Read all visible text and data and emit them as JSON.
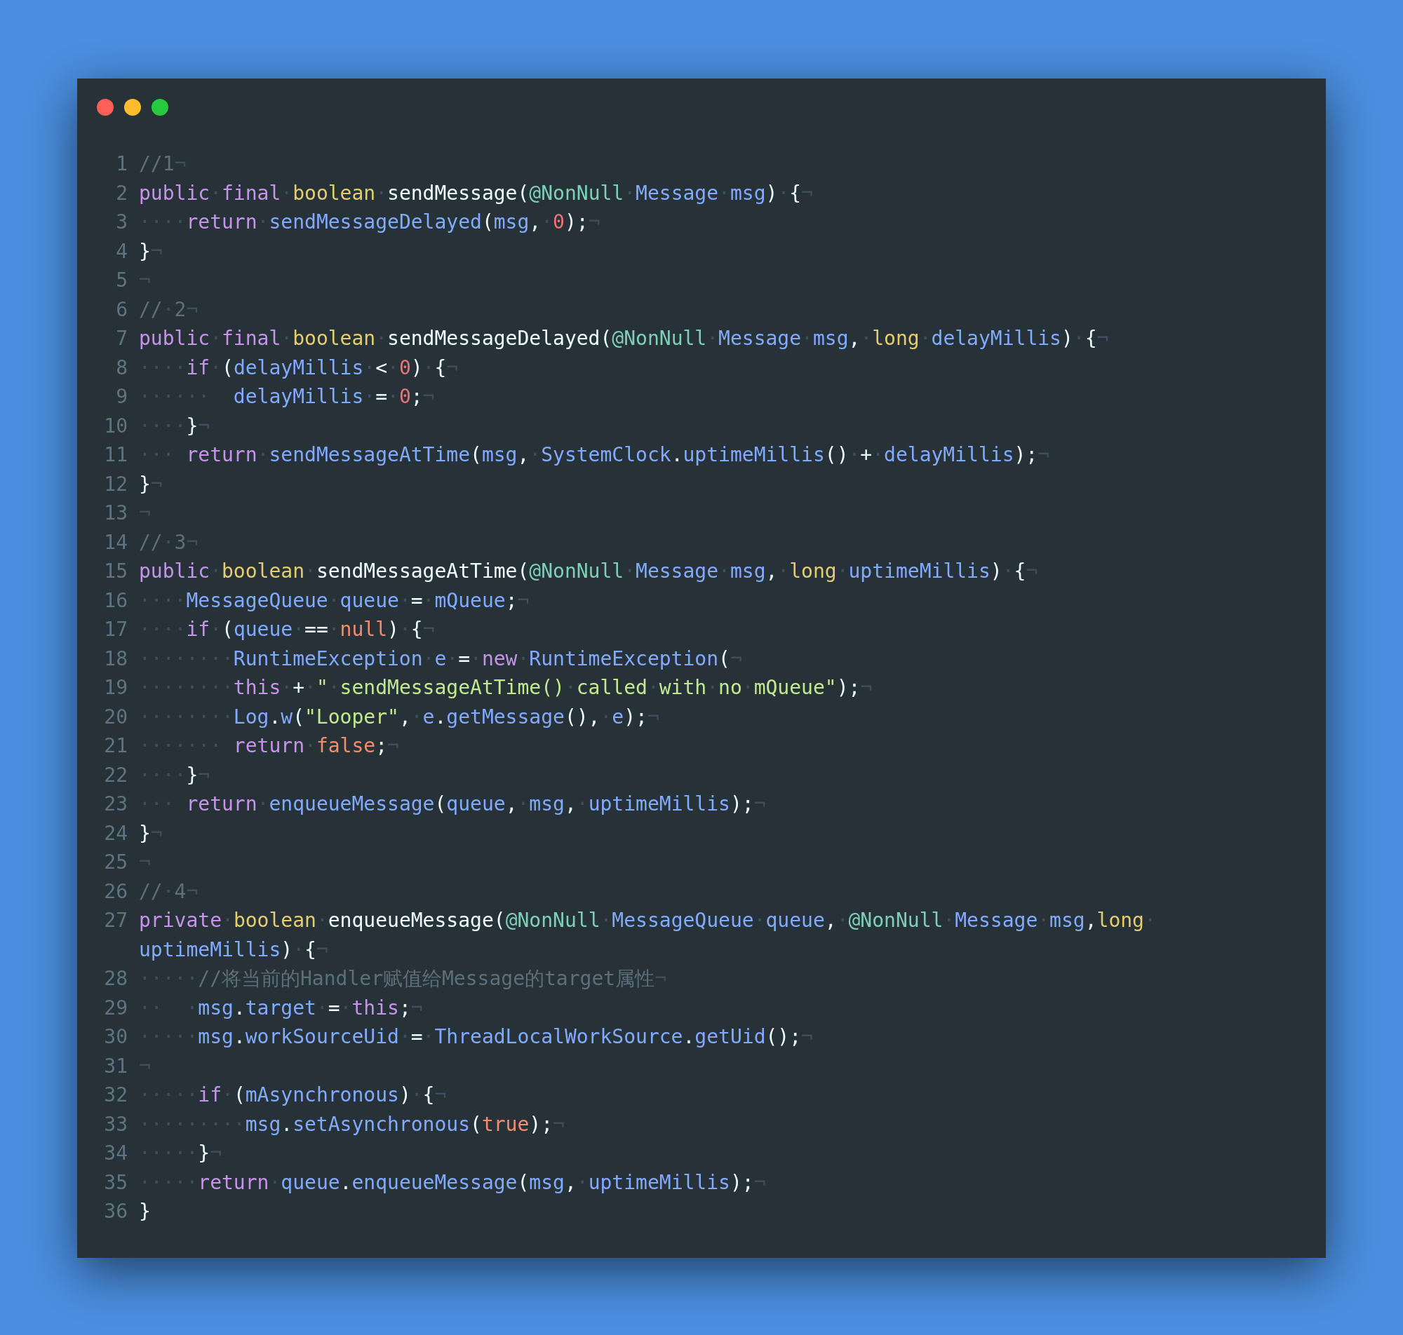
{
  "window": {
    "controls": [
      {
        "color": "#ff5f56"
      },
      {
        "color": "#ffbd2e"
      },
      {
        "color": "#27c93f"
      }
    ]
  },
  "code": {
    "lines": [
      {
        "number": "1",
        "tokens": [
          {
            "kind": "c",
            "text": "//1"
          },
          {
            "kind": "w",
            "text": "¬"
          }
        ]
      },
      {
        "number": "2",
        "tokens": [
          {
            "kind": "k",
            "text": "public"
          },
          {
            "kind": "w",
            "text": "·"
          },
          {
            "kind": "k",
            "text": "final"
          },
          {
            "kind": "w",
            "text": "·"
          },
          {
            "kind": "t",
            "text": "boolean"
          },
          {
            "kind": "w",
            "text": "·"
          },
          {
            "kind": "d",
            "text": "sendMessage"
          },
          {
            "kind": "p",
            "text": "("
          },
          {
            "kind": "a",
            "text": "@NonNull"
          },
          {
            "kind": "w",
            "text": "·"
          },
          {
            "kind": "i",
            "text": "Message"
          },
          {
            "kind": "w",
            "text": "·"
          },
          {
            "kind": "i",
            "text": "msg"
          },
          {
            "kind": "p",
            "text": ")"
          },
          {
            "kind": "w",
            "text": "·"
          },
          {
            "kind": "p",
            "text": "{"
          },
          {
            "kind": "w",
            "text": "¬"
          }
        ]
      },
      {
        "number": "3",
        "tokens": [
          {
            "kind": "w",
            "text": "····"
          },
          {
            "kind": "k",
            "text": "return"
          },
          {
            "kind": "w",
            "text": "·"
          },
          {
            "kind": "i",
            "text": "sendMessageDelayed"
          },
          {
            "kind": "p",
            "text": "("
          },
          {
            "kind": "i",
            "text": "msg"
          },
          {
            "kind": "p",
            "text": ","
          },
          {
            "kind": "w",
            "text": "·"
          },
          {
            "kind": "n",
            "text": "0"
          },
          {
            "kind": "p",
            "text": ");"
          },
          {
            "kind": "w",
            "text": "¬"
          }
        ]
      },
      {
        "number": "4",
        "tokens": [
          {
            "kind": "p",
            "text": "}"
          },
          {
            "kind": "w",
            "text": "¬"
          }
        ]
      },
      {
        "number": "5",
        "tokens": [
          {
            "kind": "w",
            "text": "¬"
          }
        ]
      },
      {
        "number": "6",
        "tokens": [
          {
            "kind": "c",
            "text": "//"
          },
          {
            "kind": "w",
            "text": "·"
          },
          {
            "kind": "c",
            "text": "2"
          },
          {
            "kind": "w",
            "text": "¬"
          }
        ]
      },
      {
        "number": "7",
        "tokens": [
          {
            "kind": "k",
            "text": "public"
          },
          {
            "kind": "w",
            "text": "·"
          },
          {
            "kind": "k",
            "text": "final"
          },
          {
            "kind": "w",
            "text": "·"
          },
          {
            "kind": "t",
            "text": "boolean"
          },
          {
            "kind": "w",
            "text": "·"
          },
          {
            "kind": "d",
            "text": "sendMessageDelayed"
          },
          {
            "kind": "p",
            "text": "("
          },
          {
            "kind": "a",
            "text": "@NonNull"
          },
          {
            "kind": "w",
            "text": "·"
          },
          {
            "kind": "i",
            "text": "Message"
          },
          {
            "kind": "w",
            "text": "·"
          },
          {
            "kind": "i",
            "text": "msg"
          },
          {
            "kind": "p",
            "text": ","
          },
          {
            "kind": "w",
            "text": "·"
          },
          {
            "kind": "t",
            "text": "long"
          },
          {
            "kind": "w",
            "text": "·"
          },
          {
            "kind": "i",
            "text": "delayMillis"
          },
          {
            "kind": "p",
            "text": ")"
          },
          {
            "kind": "w",
            "text": "·"
          },
          {
            "kind": "p",
            "text": "{"
          },
          {
            "kind": "w",
            "text": "¬"
          }
        ]
      },
      {
        "number": "8",
        "tokens": [
          {
            "kind": "w",
            "text": "····"
          },
          {
            "kind": "k",
            "text": "if"
          },
          {
            "kind": "w",
            "text": "·"
          },
          {
            "kind": "p",
            "text": "("
          },
          {
            "kind": "i",
            "text": "delayMillis"
          },
          {
            "kind": "w",
            "text": "·"
          },
          {
            "kind": "p",
            "text": "<"
          },
          {
            "kind": "w",
            "text": "·"
          },
          {
            "kind": "n",
            "text": "0"
          },
          {
            "kind": "p",
            "text": ")"
          },
          {
            "kind": "w",
            "text": "·"
          },
          {
            "kind": "p",
            "text": "{"
          },
          {
            "kind": "w",
            "text": "¬"
          }
        ]
      },
      {
        "number": "9",
        "tokens": [
          {
            "kind": "w",
            "text": "······  "
          },
          {
            "kind": "i",
            "text": "delayMillis"
          },
          {
            "kind": "w",
            "text": "·"
          },
          {
            "kind": "p",
            "text": "="
          },
          {
            "kind": "w",
            "text": "·"
          },
          {
            "kind": "n",
            "text": "0"
          },
          {
            "kind": "p",
            "text": ";"
          },
          {
            "kind": "w",
            "text": "¬"
          }
        ]
      },
      {
        "number": "10",
        "tokens": [
          {
            "kind": "w",
            "text": "····"
          },
          {
            "kind": "p",
            "text": "}"
          },
          {
            "kind": "w",
            "text": "¬"
          }
        ]
      },
      {
        "number": "11",
        "tokens": [
          {
            "kind": "w",
            "text": "··· "
          },
          {
            "kind": "k",
            "text": "return"
          },
          {
            "kind": "w",
            "text": "·"
          },
          {
            "kind": "i",
            "text": "sendMessageAtTime"
          },
          {
            "kind": "p",
            "text": "("
          },
          {
            "kind": "i",
            "text": "msg"
          },
          {
            "kind": "p",
            "text": ","
          },
          {
            "kind": "w",
            "text": "·"
          },
          {
            "kind": "i",
            "text": "SystemClock"
          },
          {
            "kind": "p",
            "text": "."
          },
          {
            "kind": "i",
            "text": "uptimeMillis"
          },
          {
            "kind": "p",
            "text": "()"
          },
          {
            "kind": "w",
            "text": "·"
          },
          {
            "kind": "p",
            "text": "+"
          },
          {
            "kind": "w",
            "text": "·"
          },
          {
            "kind": "i",
            "text": "delayMillis"
          },
          {
            "kind": "p",
            "text": ");"
          },
          {
            "kind": "w",
            "text": "¬"
          }
        ]
      },
      {
        "number": "12",
        "tokens": [
          {
            "kind": "p",
            "text": "}"
          },
          {
            "kind": "w",
            "text": "¬"
          }
        ]
      },
      {
        "number": "13",
        "tokens": [
          {
            "kind": "w",
            "text": "¬"
          }
        ]
      },
      {
        "number": "14",
        "tokens": [
          {
            "kind": "c",
            "text": "//"
          },
          {
            "kind": "w",
            "text": "·"
          },
          {
            "kind": "c",
            "text": "3"
          },
          {
            "kind": "w",
            "text": "¬"
          }
        ]
      },
      {
        "number": "15",
        "tokens": [
          {
            "kind": "k",
            "text": "public"
          },
          {
            "kind": "w",
            "text": "·"
          },
          {
            "kind": "t",
            "text": "boolean"
          },
          {
            "kind": "w",
            "text": "·"
          },
          {
            "kind": "d",
            "text": "sendMessageAtTime"
          },
          {
            "kind": "p",
            "text": "("
          },
          {
            "kind": "a",
            "text": "@NonNull"
          },
          {
            "kind": "w",
            "text": "·"
          },
          {
            "kind": "i",
            "text": "Message"
          },
          {
            "kind": "w",
            "text": "·"
          },
          {
            "kind": "i",
            "text": "msg"
          },
          {
            "kind": "p",
            "text": ","
          },
          {
            "kind": "w",
            "text": "·"
          },
          {
            "kind": "t",
            "text": "long"
          },
          {
            "kind": "w",
            "text": "·"
          },
          {
            "kind": "i",
            "text": "uptimeMillis"
          },
          {
            "kind": "p",
            "text": ")"
          },
          {
            "kind": "w",
            "text": "·"
          },
          {
            "kind": "p",
            "text": "{"
          },
          {
            "kind": "w",
            "text": "¬"
          }
        ]
      },
      {
        "number": "16",
        "tokens": [
          {
            "kind": "w",
            "text": "····"
          },
          {
            "kind": "i",
            "text": "MessageQueue"
          },
          {
            "kind": "w",
            "text": "·"
          },
          {
            "kind": "i",
            "text": "queue"
          },
          {
            "kind": "w",
            "text": "·"
          },
          {
            "kind": "p",
            "text": "="
          },
          {
            "kind": "w",
            "text": "·"
          },
          {
            "kind": "i",
            "text": "mQueue"
          },
          {
            "kind": "p",
            "text": ";"
          },
          {
            "kind": "w",
            "text": "¬"
          }
        ]
      },
      {
        "number": "17",
        "tokens": [
          {
            "kind": "w",
            "text": "····"
          },
          {
            "kind": "k",
            "text": "if"
          },
          {
            "kind": "w",
            "text": "·"
          },
          {
            "kind": "p",
            "text": "("
          },
          {
            "kind": "i",
            "text": "queue"
          },
          {
            "kind": "w",
            "text": "·"
          },
          {
            "kind": "p",
            "text": "=="
          },
          {
            "kind": "w",
            "text": "·"
          },
          {
            "kind": "l",
            "text": "null"
          },
          {
            "kind": "p",
            "text": ")"
          },
          {
            "kind": "w",
            "text": "·"
          },
          {
            "kind": "p",
            "text": "{"
          },
          {
            "kind": "w",
            "text": "¬"
          }
        ]
      },
      {
        "number": "18",
        "tokens": [
          {
            "kind": "w",
            "text": "········"
          },
          {
            "kind": "i",
            "text": "RuntimeException"
          },
          {
            "kind": "w",
            "text": "·"
          },
          {
            "kind": "i",
            "text": "e"
          },
          {
            "kind": "w",
            "text": "·"
          },
          {
            "kind": "p",
            "text": "="
          },
          {
            "kind": "w",
            "text": "·"
          },
          {
            "kind": "k",
            "text": "new"
          },
          {
            "kind": "w",
            "text": "·"
          },
          {
            "kind": "i",
            "text": "RuntimeException"
          },
          {
            "kind": "p",
            "text": "("
          },
          {
            "kind": "w",
            "text": "¬"
          }
        ]
      },
      {
        "number": "19",
        "tokens": [
          {
            "kind": "w",
            "text": "········"
          },
          {
            "kind": "k",
            "text": "this"
          },
          {
            "kind": "w",
            "text": "·"
          },
          {
            "kind": "p",
            "text": "+"
          },
          {
            "kind": "w",
            "text": "·"
          },
          {
            "kind": "s",
            "text": "\""
          },
          {
            "kind": "w",
            "text": "·"
          },
          {
            "kind": "s",
            "text": "sendMessageAtTime()"
          },
          {
            "kind": "w",
            "text": "·"
          },
          {
            "kind": "s",
            "text": "called"
          },
          {
            "kind": "w",
            "text": "·"
          },
          {
            "kind": "s",
            "text": "with"
          },
          {
            "kind": "w",
            "text": "·"
          },
          {
            "kind": "s",
            "text": "no"
          },
          {
            "kind": "w",
            "text": "·"
          },
          {
            "kind": "s",
            "text": "mQueue\""
          },
          {
            "kind": "p",
            "text": ");"
          },
          {
            "kind": "w",
            "text": "¬"
          }
        ]
      },
      {
        "number": "20",
        "tokens": [
          {
            "kind": "w",
            "text": "········"
          },
          {
            "kind": "i",
            "text": "Log"
          },
          {
            "kind": "p",
            "text": "."
          },
          {
            "kind": "i",
            "text": "w"
          },
          {
            "kind": "p",
            "text": "("
          },
          {
            "kind": "s",
            "text": "\"Looper\""
          },
          {
            "kind": "p",
            "text": ","
          },
          {
            "kind": "w",
            "text": "·"
          },
          {
            "kind": "i",
            "text": "e"
          },
          {
            "kind": "p",
            "text": "."
          },
          {
            "kind": "i",
            "text": "getMessage"
          },
          {
            "kind": "p",
            "text": "(),"
          },
          {
            "kind": "w",
            "text": "·"
          },
          {
            "kind": "i",
            "text": "e"
          },
          {
            "kind": "p",
            "text": ");"
          },
          {
            "kind": "w",
            "text": "¬"
          }
        ]
      },
      {
        "number": "21",
        "tokens": [
          {
            "kind": "w",
            "text": "······· "
          },
          {
            "kind": "k",
            "text": "return"
          },
          {
            "kind": "w",
            "text": "·"
          },
          {
            "kind": "l",
            "text": "false"
          },
          {
            "kind": "p",
            "text": ";"
          },
          {
            "kind": "w",
            "text": "¬"
          }
        ]
      },
      {
        "number": "22",
        "tokens": [
          {
            "kind": "w",
            "text": "····"
          },
          {
            "kind": "p",
            "text": "}"
          },
          {
            "kind": "w",
            "text": "¬"
          }
        ]
      },
      {
        "number": "23",
        "tokens": [
          {
            "kind": "w",
            "text": "··· "
          },
          {
            "kind": "k",
            "text": "return"
          },
          {
            "kind": "w",
            "text": "·"
          },
          {
            "kind": "i",
            "text": "enqueueMessage"
          },
          {
            "kind": "p",
            "text": "("
          },
          {
            "kind": "i",
            "text": "queue"
          },
          {
            "kind": "p",
            "text": ","
          },
          {
            "kind": "w",
            "text": "·"
          },
          {
            "kind": "i",
            "text": "msg"
          },
          {
            "kind": "p",
            "text": ","
          },
          {
            "kind": "w",
            "text": "·"
          },
          {
            "kind": "i",
            "text": "uptimeMillis"
          },
          {
            "kind": "p",
            "text": ");"
          },
          {
            "kind": "w",
            "text": "¬"
          }
        ]
      },
      {
        "number": "24",
        "tokens": [
          {
            "kind": "p",
            "text": "}"
          },
          {
            "kind": "w",
            "text": "¬"
          }
        ]
      },
      {
        "number": "25",
        "tokens": [
          {
            "kind": "w",
            "text": "¬"
          }
        ]
      },
      {
        "number": "26",
        "tokens": [
          {
            "kind": "c",
            "text": "//"
          },
          {
            "kind": "w",
            "text": "·"
          },
          {
            "kind": "c",
            "text": "4"
          },
          {
            "kind": "w",
            "text": "¬"
          }
        ]
      },
      {
        "number": "27",
        "tokens": [
          {
            "kind": "k",
            "text": "private"
          },
          {
            "kind": "w",
            "text": "·"
          },
          {
            "kind": "t",
            "text": "boolean"
          },
          {
            "kind": "w",
            "text": "·"
          },
          {
            "kind": "d",
            "text": "enqueueMessage"
          },
          {
            "kind": "p",
            "text": "("
          },
          {
            "kind": "a",
            "text": "@NonNull"
          },
          {
            "kind": "w",
            "text": "·"
          },
          {
            "kind": "i",
            "text": "MessageQueue"
          },
          {
            "kind": "w",
            "text": "·"
          },
          {
            "kind": "i",
            "text": "queue"
          },
          {
            "kind": "p",
            "text": ","
          },
          {
            "kind": "w",
            "text": "·"
          },
          {
            "kind": "a",
            "text": "@NonNull"
          },
          {
            "kind": "w",
            "text": "·"
          },
          {
            "kind": "i",
            "text": "Message"
          },
          {
            "kind": "w",
            "text": "·"
          },
          {
            "kind": "i",
            "text": "msg"
          },
          {
            "kind": "p",
            "text": ","
          },
          {
            "kind": "t",
            "text": "long"
          },
          {
            "kind": "w",
            "text": "·"
          }
        ],
        "wrapped": [
          {
            "kind": "i",
            "text": "uptimeMillis"
          },
          {
            "kind": "p",
            "text": ")"
          },
          {
            "kind": "w",
            "text": "·"
          },
          {
            "kind": "p",
            "text": "{"
          },
          {
            "kind": "w",
            "text": "¬"
          }
        ]
      },
      {
        "number": "28",
        "tokens": [
          {
            "kind": "w",
            "text": "·····"
          },
          {
            "kind": "c",
            "text": "//将当前的Handler赋值给Message的target属性"
          },
          {
            "kind": "w",
            "text": "¬"
          }
        ]
      },
      {
        "number": "29",
        "tokens": [
          {
            "kind": "w",
            "text": "··  ·"
          },
          {
            "kind": "i",
            "text": "msg"
          },
          {
            "kind": "p",
            "text": "."
          },
          {
            "kind": "i",
            "text": "target"
          },
          {
            "kind": "w",
            "text": "·"
          },
          {
            "kind": "p",
            "text": "="
          },
          {
            "kind": "w",
            "text": "·"
          },
          {
            "kind": "k",
            "text": "this"
          },
          {
            "kind": "p",
            "text": ";"
          },
          {
            "kind": "w",
            "text": "¬"
          }
        ]
      },
      {
        "number": "30",
        "tokens": [
          {
            "kind": "w",
            "text": "·····"
          },
          {
            "kind": "i",
            "text": "msg"
          },
          {
            "kind": "p",
            "text": "."
          },
          {
            "kind": "i",
            "text": "workSourceUid"
          },
          {
            "kind": "w",
            "text": "·"
          },
          {
            "kind": "p",
            "text": "="
          },
          {
            "kind": "w",
            "text": "·"
          },
          {
            "kind": "i",
            "text": "ThreadLocalWorkSource"
          },
          {
            "kind": "p",
            "text": "."
          },
          {
            "kind": "i",
            "text": "getUid"
          },
          {
            "kind": "p",
            "text": "();"
          },
          {
            "kind": "w",
            "text": "¬"
          }
        ]
      },
      {
        "number": "31",
        "tokens": [
          {
            "kind": "w",
            "text": "¬"
          }
        ]
      },
      {
        "number": "32",
        "tokens": [
          {
            "kind": "w",
            "text": "·····"
          },
          {
            "kind": "k",
            "text": "if"
          },
          {
            "kind": "w",
            "text": "·"
          },
          {
            "kind": "p",
            "text": "("
          },
          {
            "kind": "i",
            "text": "mAsynchronous"
          },
          {
            "kind": "p",
            "text": ")"
          },
          {
            "kind": "w",
            "text": "·"
          },
          {
            "kind": "p",
            "text": "{"
          },
          {
            "kind": "w",
            "text": "¬"
          }
        ]
      },
      {
        "number": "33",
        "tokens": [
          {
            "kind": "w",
            "text": "·········"
          },
          {
            "kind": "i",
            "text": "msg"
          },
          {
            "kind": "p",
            "text": "."
          },
          {
            "kind": "i",
            "text": "setAsynchronous"
          },
          {
            "kind": "p",
            "text": "("
          },
          {
            "kind": "l",
            "text": "true"
          },
          {
            "kind": "p",
            "text": ");"
          },
          {
            "kind": "w",
            "text": "¬"
          }
        ]
      },
      {
        "number": "34",
        "tokens": [
          {
            "kind": "w",
            "text": "·····"
          },
          {
            "kind": "p",
            "text": "}"
          },
          {
            "kind": "w",
            "text": "¬"
          }
        ]
      },
      {
        "number": "35",
        "tokens": [
          {
            "kind": "w",
            "text": "·····"
          },
          {
            "kind": "k",
            "text": "return"
          },
          {
            "kind": "w",
            "text": "·"
          },
          {
            "kind": "i",
            "text": "queue"
          },
          {
            "kind": "p",
            "text": "."
          },
          {
            "kind": "i",
            "text": "enqueueMessage"
          },
          {
            "kind": "p",
            "text": "("
          },
          {
            "kind": "i",
            "text": "msg"
          },
          {
            "kind": "p",
            "text": ","
          },
          {
            "kind": "w",
            "text": "·"
          },
          {
            "kind": "i",
            "text": "uptimeMillis"
          },
          {
            "kind": "p",
            "text": ");"
          },
          {
            "kind": "w",
            "text": "¬"
          }
        ]
      },
      {
        "number": "36",
        "tokens": [
          {
            "kind": "p",
            "text": "}"
          }
        ]
      }
    ]
  }
}
